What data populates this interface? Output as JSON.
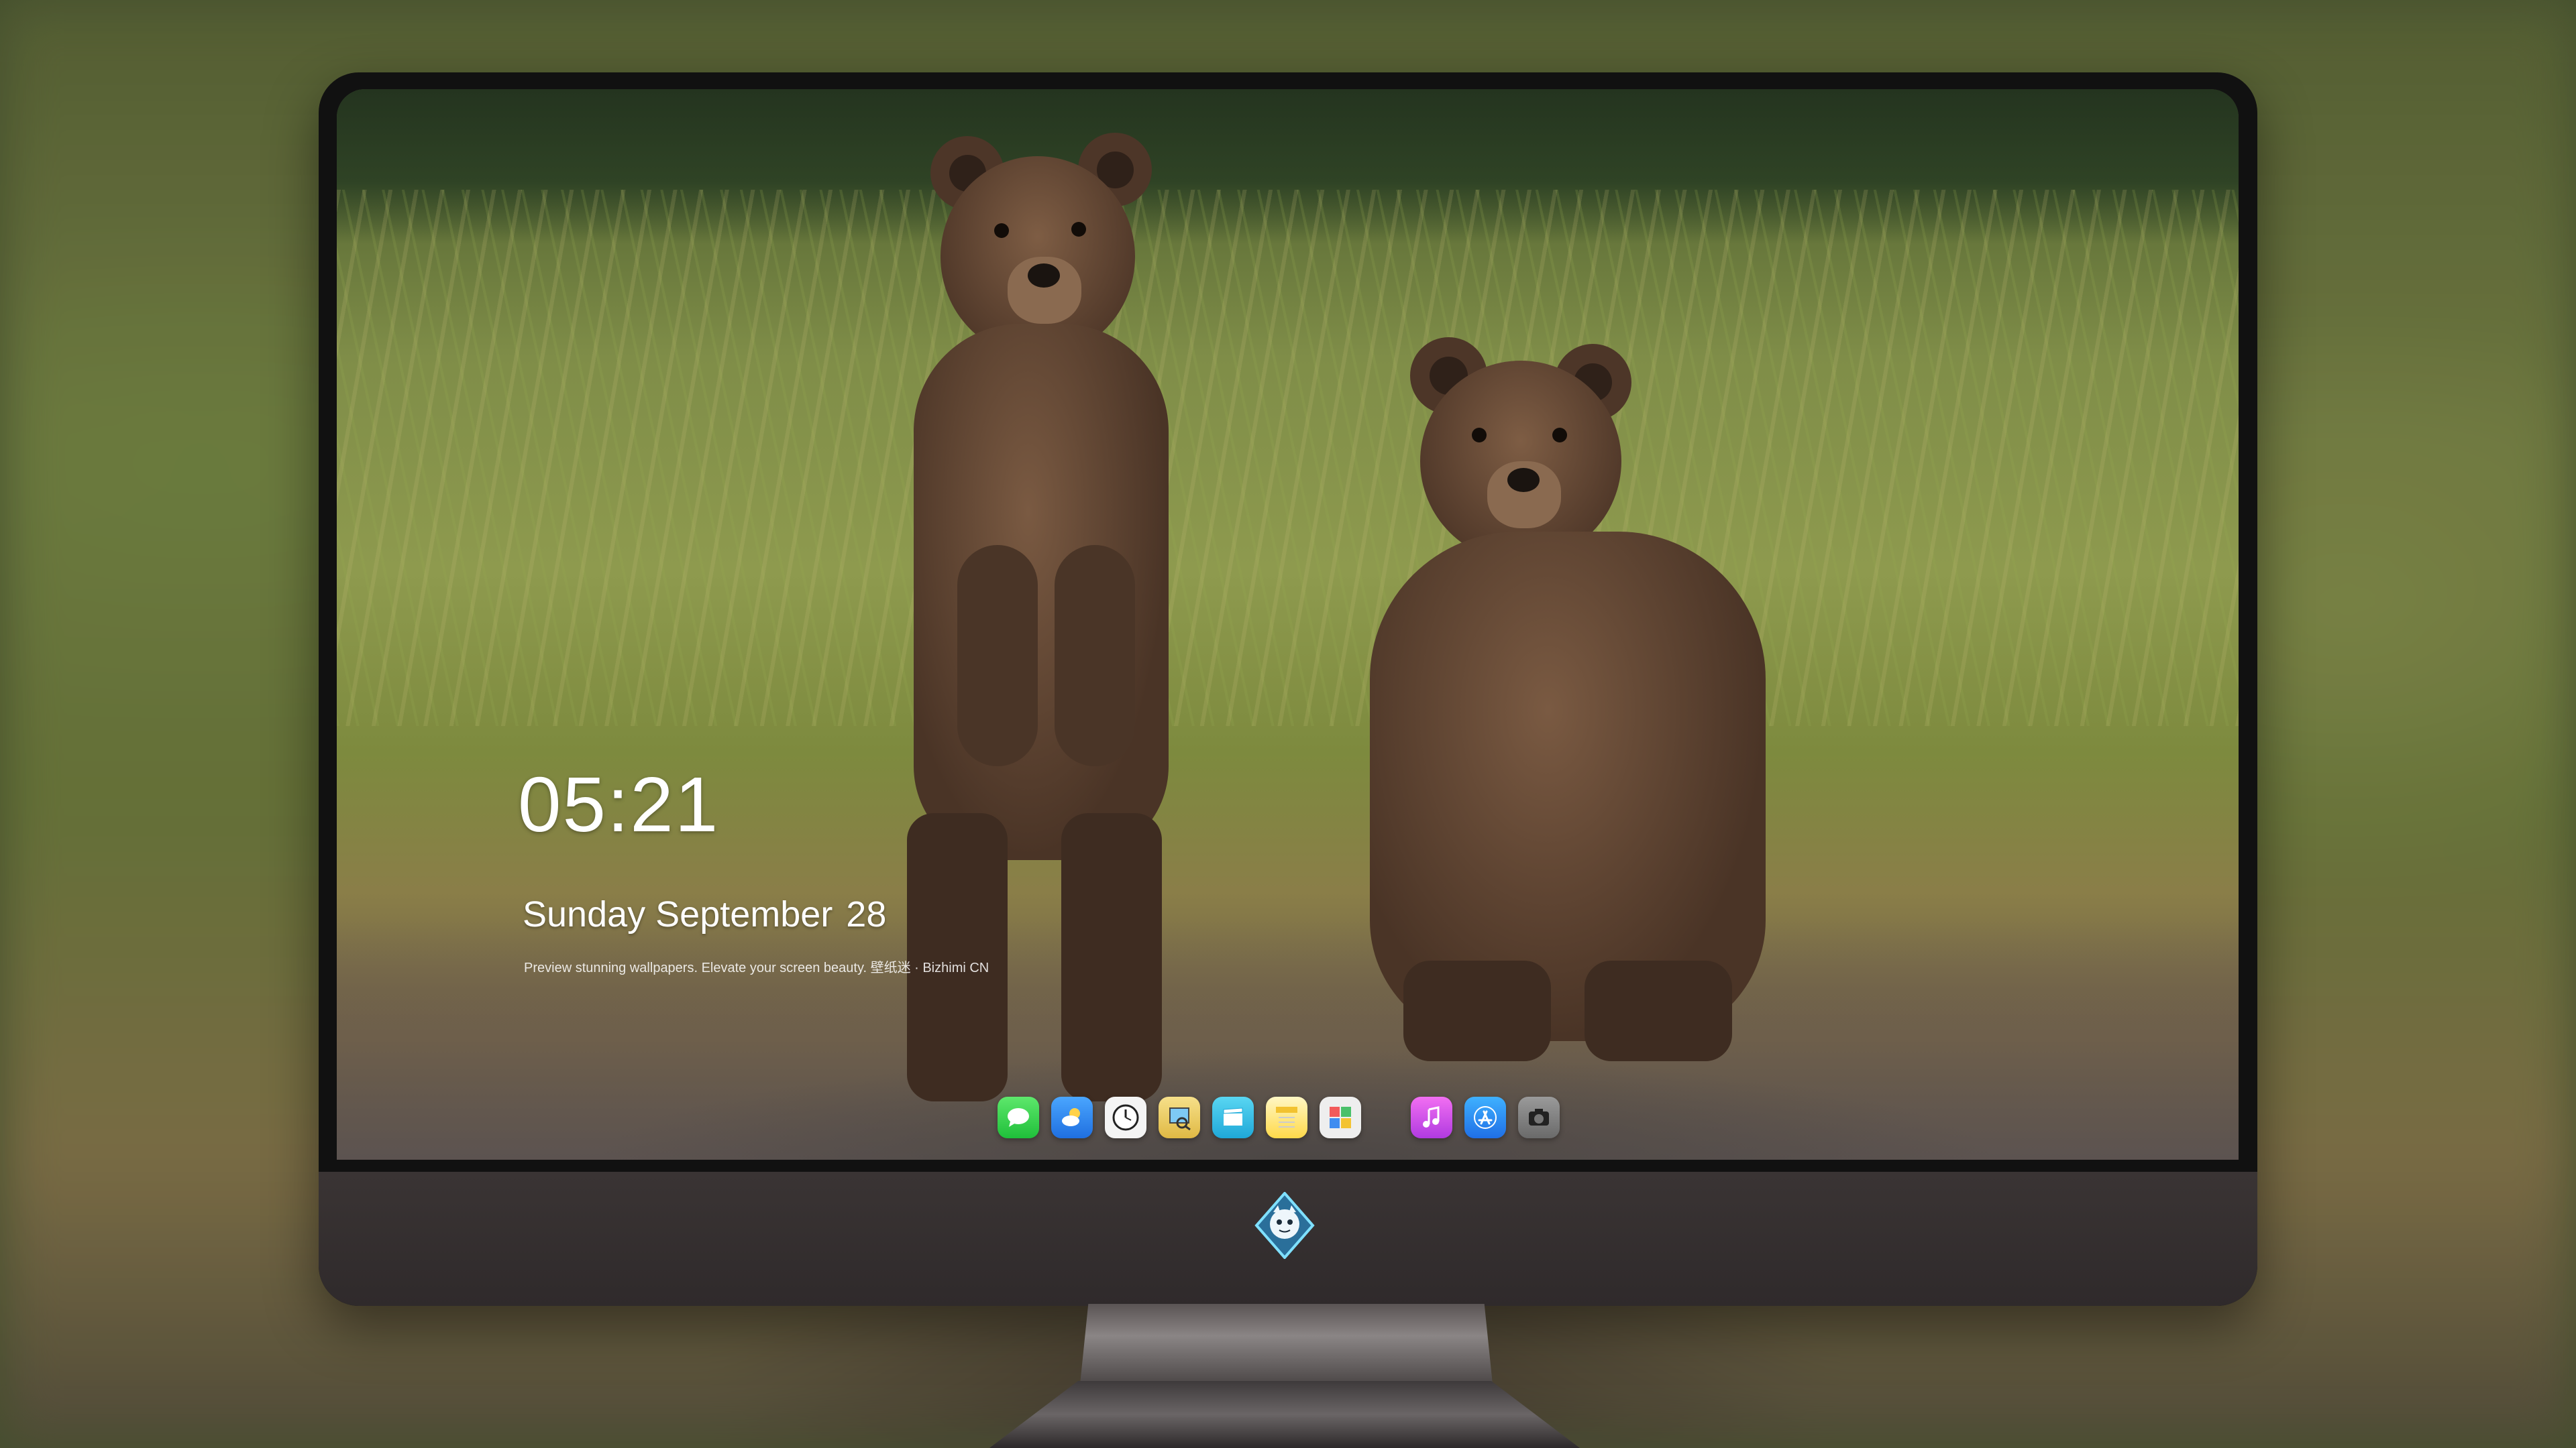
{
  "lock_screen": {
    "time": "05:21",
    "date_text": "Sunday September",
    "date_day": "28",
    "caption": "Preview stunning wallpapers. Elevate your screen beauty. 壁纸迷 · Bizhimi CN"
  },
  "dock": {
    "apps": [
      {
        "name": "Messages",
        "icon": "messages-icon",
        "color": "#3ad14f"
      },
      {
        "name": "Weather",
        "icon": "weather-icon",
        "color": "#2f8ff0"
      },
      {
        "name": "Clock",
        "icon": "clock-icon",
        "color": "#ffffff"
      },
      {
        "name": "Preview",
        "icon": "preview-icon",
        "color": "#e9d06a"
      },
      {
        "name": "Clips",
        "icon": "clapperboard-icon",
        "color": "#36c3e8"
      },
      {
        "name": "Notes",
        "icon": "notes-icon",
        "color": "#ffd94a"
      },
      {
        "name": "Photo Booth",
        "icon": "photo-icon",
        "color": "#e6e6e6"
      },
      {
        "name": "Music",
        "icon": "music-icon",
        "color": "#d94cd6"
      },
      {
        "name": "App Store",
        "icon": "app-store-icon",
        "color": "#1f8ff6"
      },
      {
        "name": "Screenshot",
        "icon": "camera-icon",
        "color": "#8a8a8a"
      }
    ]
  },
  "monitor": {
    "brand_logo": "dragon-mascot-logo"
  }
}
